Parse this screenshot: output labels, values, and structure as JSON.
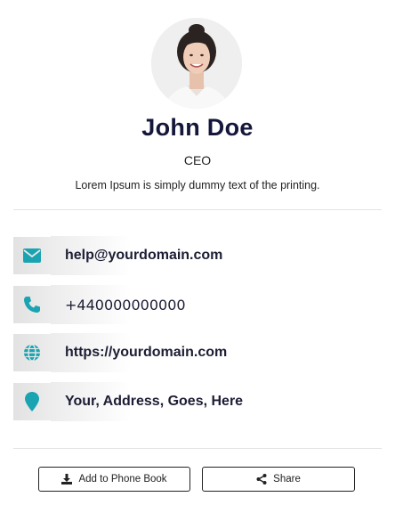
{
  "profile": {
    "name": "John Doe",
    "role": "CEO",
    "bio": "Lorem Ipsum is simply dummy text of the printing."
  },
  "contacts": [
    {
      "icon": "envelope-icon",
      "value": "help@yourdomain.com"
    },
    {
      "icon": "phone-icon",
      "value": "+440000000000"
    },
    {
      "icon": "globe-icon",
      "value": "https://yourdomain.com"
    },
    {
      "icon": "map-pin-icon",
      "value": "Your, Address, Goes, Here"
    }
  ],
  "actions": {
    "add_label": "Add to Phone Book",
    "share_label": "Share"
  },
  "colors": {
    "accent": "#1aa3b1",
    "name": "#14163a",
    "icon_box": "#e6e6e6"
  }
}
